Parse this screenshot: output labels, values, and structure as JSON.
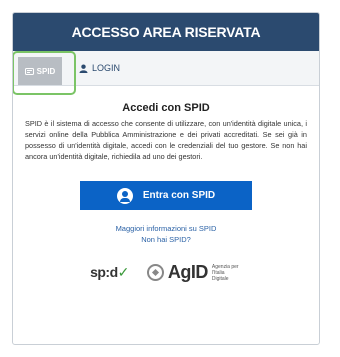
{
  "header": {
    "title": "ACCESSO AREA RISERVATA"
  },
  "tabs": [
    {
      "label": "SPID",
      "icon": "id-card-icon",
      "active": true
    },
    {
      "label": "LOGIN",
      "icon": "user-icon",
      "active": false
    }
  ],
  "spid": {
    "title": "Accedi con SPID",
    "description": "SPID è il sistema di accesso che consente di utilizzare, con un'identità digitale unica, i servizi online della Pubblica Amministrazione e dei privati accreditati. Se sei già in possesso di un'identità digitale, accedi con le credenziali del tuo gestore. Se non hai ancora un'identità digitale, richiedila ad uno dei gestori.",
    "button_label": "Entra con SPID",
    "link_more_info": "Maggiori informazioni su SPID",
    "link_no_spid": "Non hai SPID?"
  },
  "logos": {
    "spid_text": "sp:d",
    "spid_check": "✓",
    "agid_text": "AgID",
    "agid_subtitle": "Agenzia per l'Italia Digitale"
  },
  "colors": {
    "header_bg": "#2b4a6f",
    "button_bg": "#0b63c6",
    "highlight": "#7bc466"
  }
}
